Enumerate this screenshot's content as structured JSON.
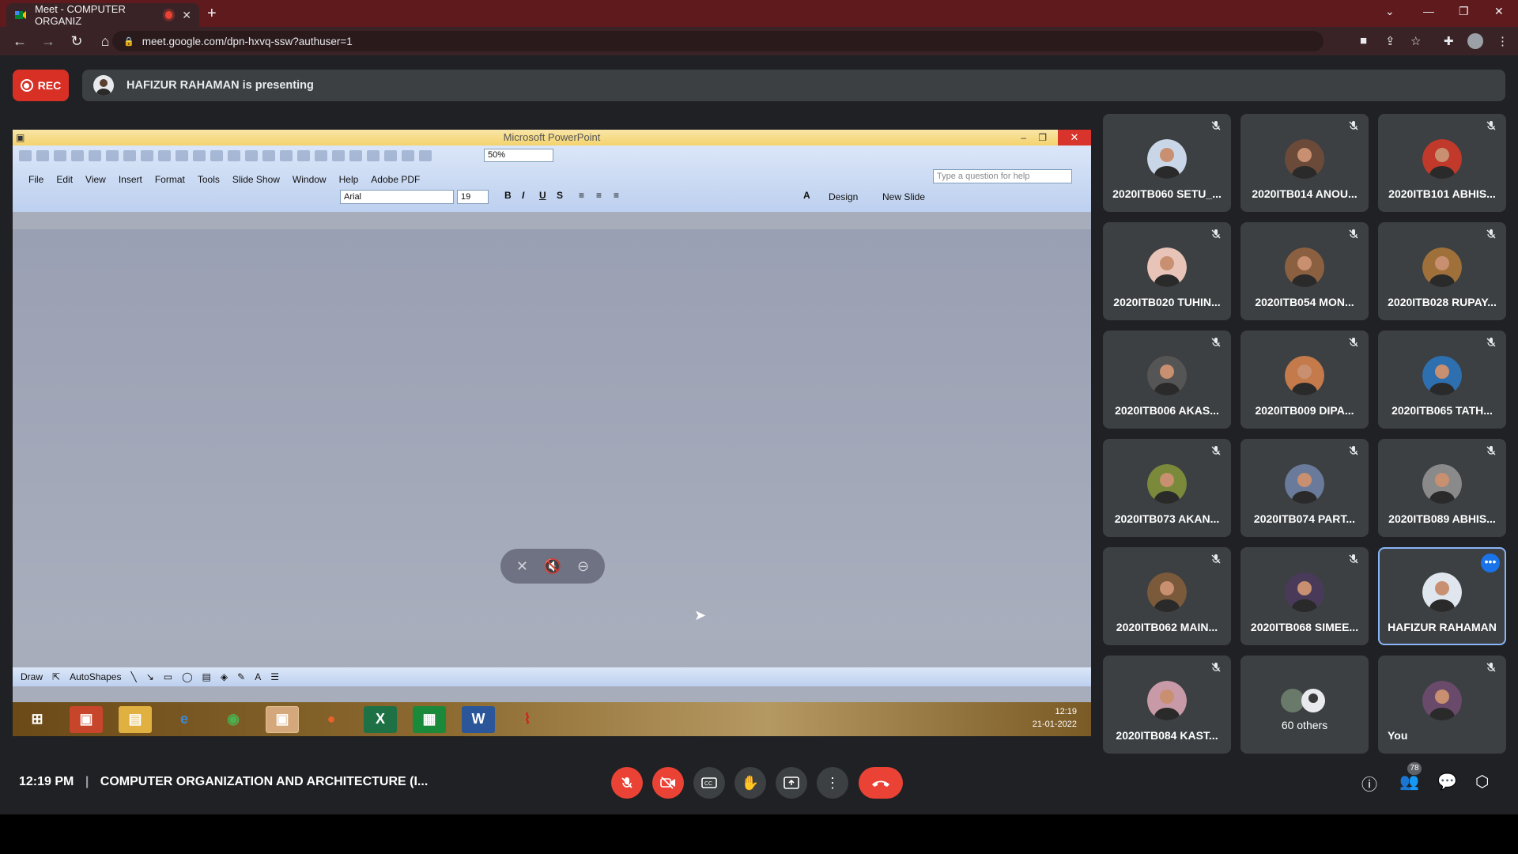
{
  "browser": {
    "tab_title": "Meet - COMPUTER ORGANIZ",
    "url": "meet.google.com/dpn-hxvq-ssw?authuser=1"
  },
  "meet": {
    "rec_label": "REC",
    "presenting_text": "HAFIZUR RAHAMAN is presenting",
    "meeting_time": "12:19 PM",
    "meeting_name": "COMPUTER ORGANIZATION AND ARCHITECTURE (I...",
    "people_count": "78"
  },
  "ppt": {
    "window_title": "Microsoft PowerPoint",
    "zoom": "50%",
    "menu": [
      "File",
      "Edit",
      "View",
      "Insert",
      "Format",
      "Tools",
      "Slide Show",
      "Window",
      "Help",
      "Adobe PDF"
    ],
    "font": "Arial",
    "font_size": "19",
    "ask_placeholder": "Type a question for help",
    "design_label": "Design",
    "new_slide_label": "New Slide",
    "draw_label": "Draw",
    "autoshapes_label": "AutoShapes",
    "clock_time": "12:19",
    "clock_date": "21-01-2022"
  },
  "participants": [
    {
      "name": "2020ITB060 SETU_...",
      "color": "#c9d6e8"
    },
    {
      "name": "2020ITB014 ANOU...",
      "color": "#6b4a3a"
    },
    {
      "name": "2020ITB101 ABHIS...",
      "color": "#c0392b"
    },
    {
      "name": "2020ITB020 TUHIN...",
      "color": "#e8c4b8"
    },
    {
      "name": "2020ITB054 MON...",
      "color": "#8a6040"
    },
    {
      "name": "2020ITB028 RUPAY...",
      "color": "#a0703a"
    },
    {
      "name": "2020ITB006 AKAS...",
      "color": "#555555"
    },
    {
      "name": "2020ITB009 DIPA...",
      "color": "#c47a4a"
    },
    {
      "name": "2020ITB065 TATH...",
      "color": "#2e6fb0"
    },
    {
      "name": "2020ITB073 AKAN...",
      "color": "#7a8a3a"
    },
    {
      "name": "2020ITB074 PART...",
      "color": "#6a7a9a"
    },
    {
      "name": "2020ITB089 ABHIS...",
      "color": "#8a8a8a"
    },
    {
      "name": "2020ITB062 MAIN...",
      "color": "#7a5a3a"
    },
    {
      "name": "2020ITB068 SIMEE...",
      "color": "#4a3a5a"
    },
    {
      "name": "HAFIZUR RAHAMAN",
      "color": "#dfe6ee"
    },
    {
      "name": "2020ITB084 KAST...",
      "color": "#c89aa8"
    },
    {
      "name": "60 others",
      "color": "#555555"
    },
    {
      "name": "You",
      "color": "#6a4a6a"
    }
  ]
}
